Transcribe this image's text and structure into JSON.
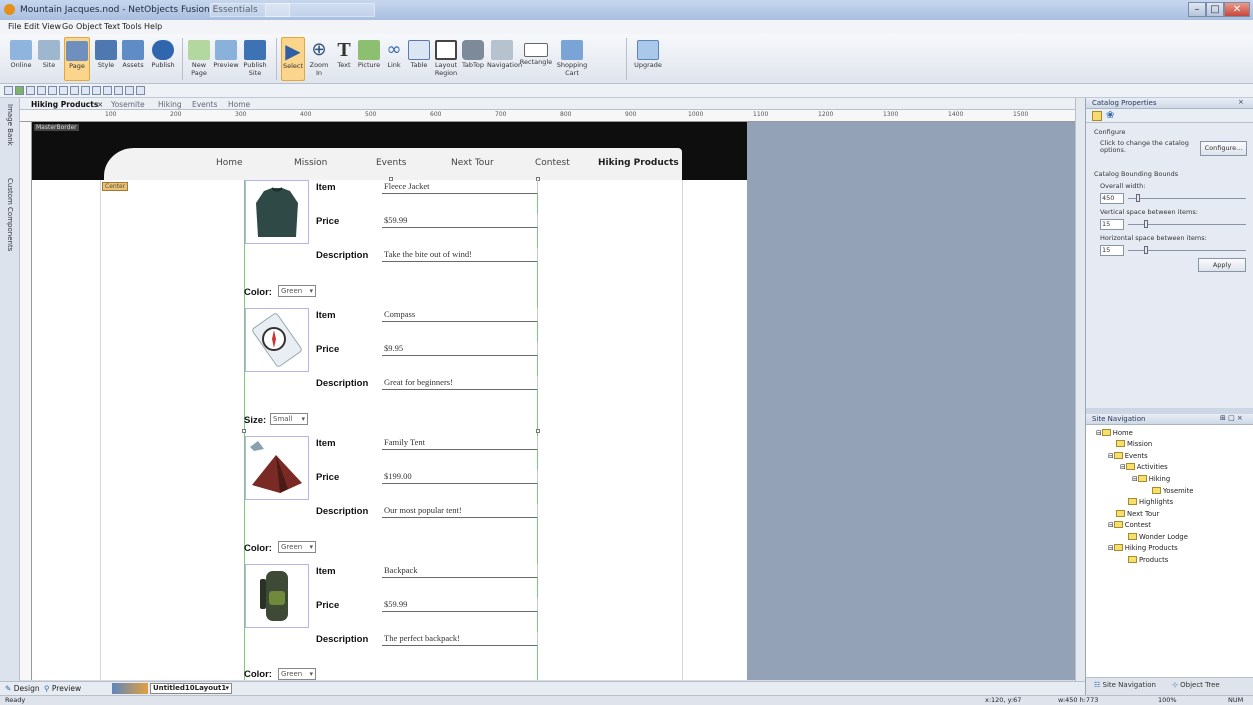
{
  "window": {
    "title": "Mountain Jacques.nod - NetObjects Fusion Essentials",
    "controls": [
      "–",
      "□",
      "✕"
    ]
  },
  "menu": [
    "File",
    "Edit",
    "View",
    "Go",
    "Object",
    "Text",
    "Tools",
    "Help"
  ],
  "toolbar": {
    "buttons": [
      {
        "label": "Online",
        "icon": "online-icon"
      },
      {
        "label": "Site",
        "icon": "site-icon"
      },
      {
        "label": "Page",
        "icon": "page-icon",
        "active": true
      },
      {
        "label": "Style",
        "icon": "style-icon"
      },
      {
        "label": "Assets",
        "icon": "assets-icon"
      },
      {
        "label": "Publish",
        "icon": "publish-icon"
      },
      {
        "label": "New\nPage",
        "icon": "new-page-icon"
      },
      {
        "label": "Preview",
        "icon": "preview-icon"
      },
      {
        "label": "Publish\nSite",
        "icon": "publish-site-icon"
      },
      {
        "label": "Select",
        "icon": "select-icon",
        "active": true
      },
      {
        "label": "Zoom\nIn",
        "icon": "zoom-icon"
      },
      {
        "label": "Text",
        "icon": "text-icon"
      },
      {
        "label": "Picture",
        "icon": "picture-icon"
      },
      {
        "label": "Link",
        "icon": "link-icon"
      },
      {
        "label": "Table",
        "icon": "table-icon"
      },
      {
        "label": "Layout\nRegion",
        "icon": "layout-region-icon"
      },
      {
        "label": "TabTop",
        "icon": "tabtop-icon"
      },
      {
        "label": "Navigation",
        "icon": "navigation-icon"
      },
      {
        "label": "Rectangle",
        "icon": "rectangle-icon"
      },
      {
        "label": "Shopping\nCart",
        "icon": "cart-icon"
      },
      {
        "label": "Upgrade",
        "icon": "upgrade-icon"
      }
    ]
  },
  "tabs": [
    "Hiking Products",
    "Yosemite",
    "Hiking",
    "Events",
    "Home"
  ],
  "tab_close": "×",
  "left_tabs": [
    "Image Bank",
    "Custom Components"
  ],
  "ruler": [
    "100",
    "200",
    "300",
    "400",
    "500",
    "600",
    "700",
    "800",
    "900",
    "1000",
    "1100",
    "1200",
    "1300",
    "1400",
    "1500"
  ],
  "page": {
    "master_label": "MasterBorder",
    "center_tag": "Center",
    "nav": [
      "Home",
      "Mission",
      "Events",
      "Next Tour",
      "Contest",
      "Hiking Products"
    ],
    "labels": {
      "item": "Item",
      "price": "Price",
      "description": "Description"
    },
    "products": [
      {
        "item": "Fleece Jacket",
        "price": "$59.99",
        "description": "Take the bite out of wind!",
        "option_label": "Color:",
        "option": "Green"
      },
      {
        "item": "Compass",
        "price": "$9.95",
        "description": "Great for beginners!",
        "option_label": "Size:",
        "option": "Small"
      },
      {
        "item": "Family Tent",
        "price": "$199.00",
        "description": "Our most popular tent!",
        "option_label": "Color:",
        "option": "Green"
      },
      {
        "item": "Backpack",
        "price": "$59.99",
        "description": "The perfect backpack!",
        "option_label": "Color:",
        "option": "Green"
      }
    ]
  },
  "bottom": {
    "design": "Design",
    "preview": "Preview",
    "layout": "Untitled10Layout1"
  },
  "status": {
    "ready": "Ready",
    "coords": "x:120, y:67",
    "size": "w:450 h:773",
    "zoom": "100%",
    "num": "NUM"
  },
  "catalog_props": {
    "title": "Catalog Properties",
    "configure_header": "Configure",
    "configure_text": "Click to change the catalog options.",
    "configure_button": "Configure...",
    "bounds_header": "Catalog Bounding Bounds",
    "overall_width_label": "Overall width:",
    "overall_width": "450",
    "vspace_label": "Vertical space between items:",
    "vspace": "15",
    "hspace_label": "Horizontal space between items:",
    "hspace": "15",
    "apply": "Apply"
  },
  "site_nav": {
    "title": "Site Navigation",
    "tree": [
      {
        "label": "Home",
        "depth": 0
      },
      {
        "label": "Mission",
        "depth": 1
      },
      {
        "label": "Events",
        "depth": 1
      },
      {
        "label": "Activities",
        "depth": 2
      },
      {
        "label": "Hiking",
        "depth": 3
      },
      {
        "label": "Yosemite",
        "depth": 4
      },
      {
        "label": "Highlights",
        "depth": 2
      },
      {
        "label": "Next Tour",
        "depth": 1
      },
      {
        "label": "Contest",
        "depth": 1
      },
      {
        "label": "Wonder Lodge",
        "depth": 2
      },
      {
        "label": "Hiking Products",
        "depth": 1
      },
      {
        "label": "Products",
        "depth": 2
      }
    ],
    "bottom_tabs": [
      "Site Navigation",
      "Object Tree"
    ]
  }
}
